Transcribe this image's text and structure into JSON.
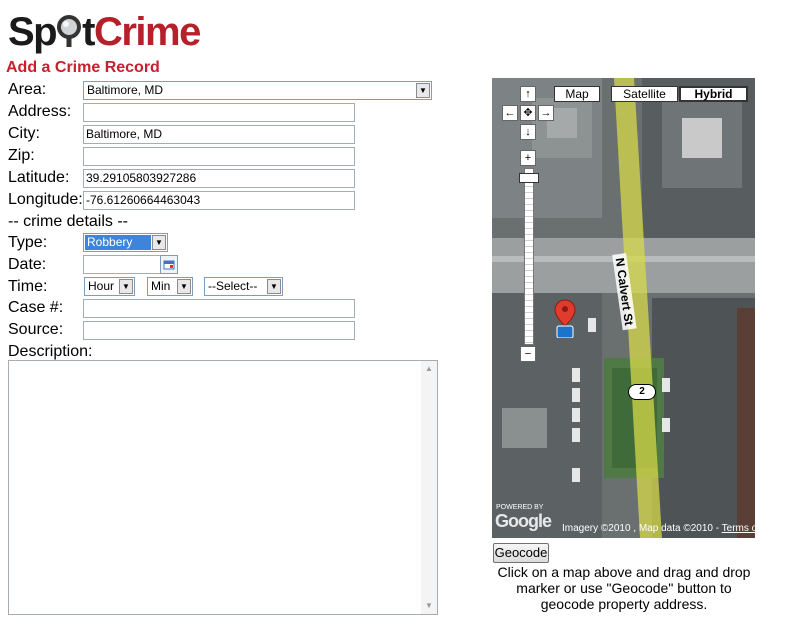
{
  "logo": {
    "part1": "Sp",
    "part2": "t",
    "part3": "Crime"
  },
  "page_heading": "Add a Crime Record",
  "form": {
    "area_label": "Area:",
    "area_value": "Baltimore, MD",
    "address_label": "Address:",
    "address_value": "",
    "city_label": "City:",
    "city_value": "Baltimore, MD",
    "zip_label": "Zip:",
    "zip_value": "",
    "latitude_label": "Latitude:",
    "latitude_value": "39.29105803927286",
    "longitude_label": "Longitude:",
    "longitude_value": "-76.61260664463043",
    "section_label": "-- crime details --",
    "type_label": "Type:",
    "type_value": "Robbery",
    "date_label": "Date:",
    "date_value": "",
    "time_label": "Time:",
    "hour_value": "Hour",
    "min_value": "Min",
    "ampm_value": "--Select--",
    "case_label": "Case #:",
    "case_value": "",
    "source_label": "Source:",
    "source_value": "",
    "description_label": "Description:",
    "description_value": ""
  },
  "map": {
    "map_type_buttons": [
      "Map",
      "Satellite",
      "Hybrid"
    ],
    "selected_type": "Hybrid",
    "street_label": "N Calvert St",
    "route_shield": "2",
    "zoom_in": "+",
    "zoom_out": "−",
    "powered_by": "POWERED BY",
    "google_logo": "Google",
    "attribution": "Imagery ©2010 , Map data ©2010 - ",
    "terms_link": "Terms of Use"
  },
  "geocode_button": "Geocode",
  "instructions": "Click on a map above and drag and drop marker or use \"Geocode\" button to geocode property address."
}
